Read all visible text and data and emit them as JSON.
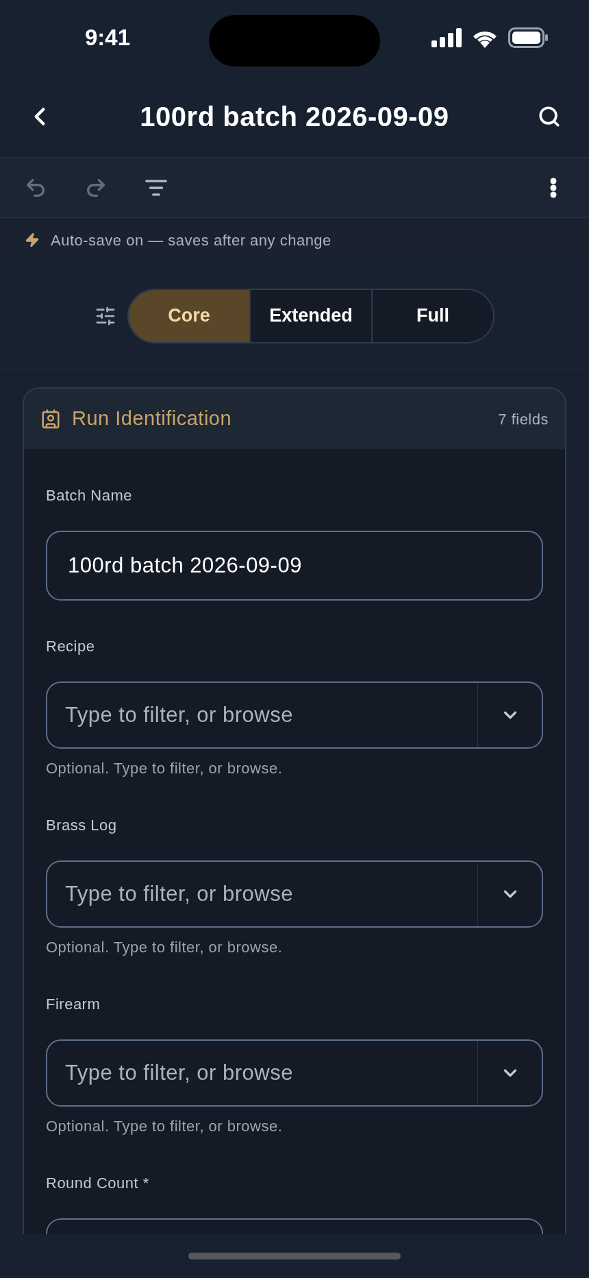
{
  "status_bar": {
    "time": "9:41"
  },
  "nav": {
    "title": "100rd batch 2026-09-09"
  },
  "toolbar": {
    "actions": [
      {
        "kind": "undo",
        "disabled": true
      },
      {
        "kind": "redo",
        "disabled": true
      },
      {
        "kind": "filter",
        "disabled": false
      }
    ]
  },
  "autosave": {
    "text": "Auto-save on — saves after any change"
  },
  "detail_levels": [
    {
      "label": "Core",
      "selected": true
    },
    {
      "label": "Extended",
      "selected": false
    },
    {
      "label": "Full",
      "selected": false
    }
  ],
  "section": {
    "title": "Run Identification",
    "count": "7 fields",
    "fields": [
      {
        "kind": "text",
        "label": "Batch Name",
        "value": "100rd batch 2026-09-09"
      },
      {
        "kind": "combo",
        "label": "Recipe",
        "placeholder": "Type to filter, or browse",
        "help": "Optional. Type to filter, or browse."
      },
      {
        "kind": "combo",
        "label": "Brass Log",
        "placeholder": "Type to filter, or browse",
        "help": "Optional. Type to filter, or browse."
      },
      {
        "kind": "combo",
        "label": "Firearm",
        "placeholder": "Type to filter, or browse",
        "help": "Optional. Type to filter, or browse."
      },
      {
        "kind": "text",
        "label": "Round Count *"
      }
    ]
  }
}
